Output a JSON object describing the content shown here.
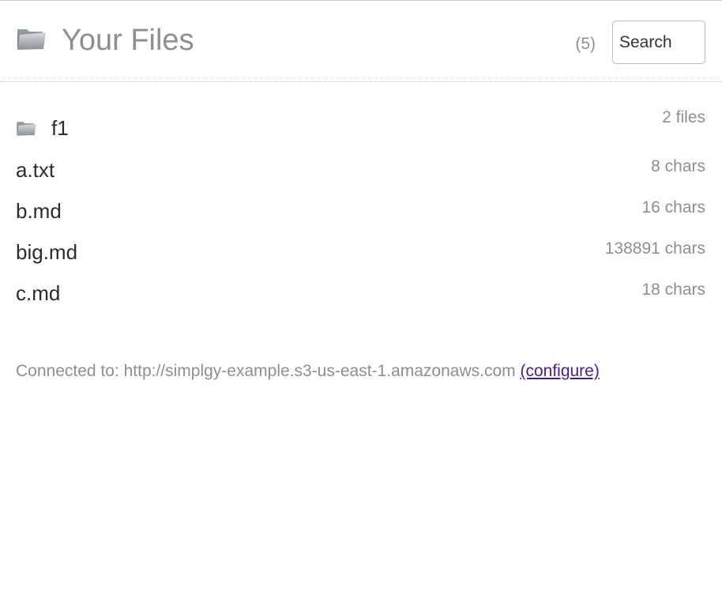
{
  "header": {
    "title": "Your Files",
    "count": "(5)",
    "search_placeholder": "Search",
    "folder_icon": "folder-icon"
  },
  "files": [
    {
      "name": "f1",
      "size": "2 files",
      "type": "folder"
    },
    {
      "name": "a.txt",
      "size": "8 chars",
      "type": "file"
    },
    {
      "name": "b.md",
      "size": "16 chars",
      "type": "file"
    },
    {
      "name": "big.md",
      "size": "138891 chars",
      "type": "file"
    },
    {
      "name": "c.md",
      "size": "18 chars",
      "type": "file"
    }
  ],
  "footer": {
    "connected_label": "Connected to: http://simplgy-example.s3-us-east-1.amazonaws.com",
    "configure_link": "(configure)"
  },
  "colors": {
    "muted_text": "#8f8f8f",
    "primary_text": "#2c2c2c",
    "link": "#4b1d86"
  }
}
